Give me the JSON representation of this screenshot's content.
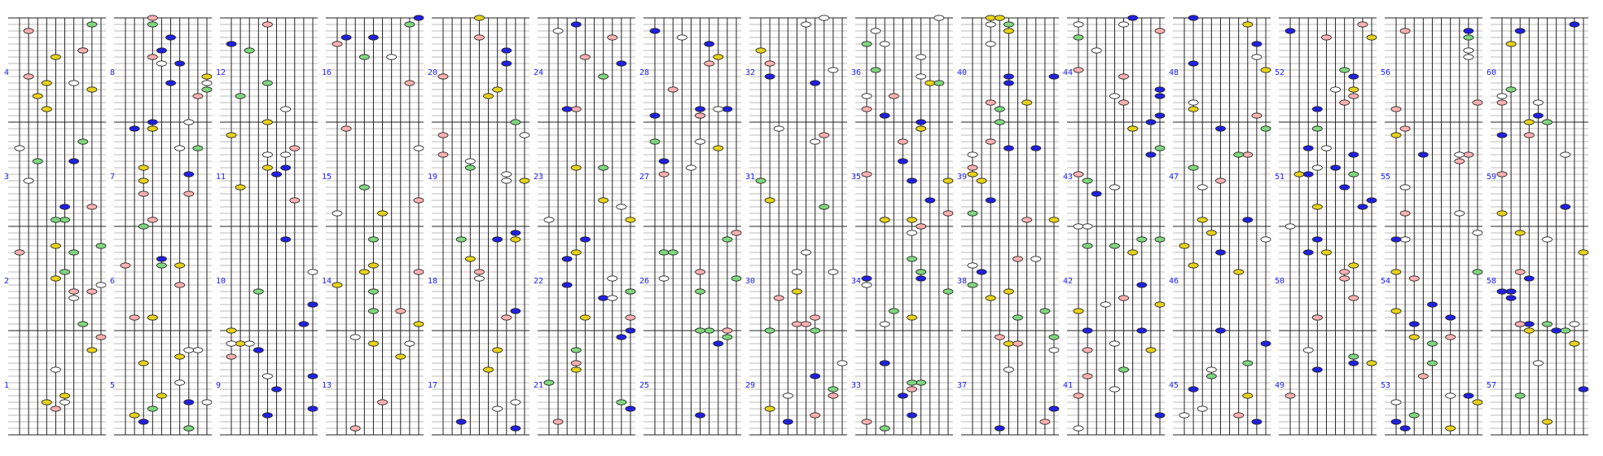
{
  "diagram": {
    "kind": "note-grid",
    "columns": 15,
    "bands_per_column": 4,
    "strings_per_column": 10,
    "band_numbers": [
      [
        4,
        3,
        2,
        1
      ],
      [
        8,
        7,
        6,
        5
      ],
      [
        12,
        11,
        10,
        9
      ],
      [
        16,
        15,
        14,
        13
      ],
      [
        20,
        19,
        18,
        17
      ],
      [
        24,
        23,
        22,
        21
      ],
      [
        28,
        27,
        26,
        25
      ],
      [
        32,
        31,
        30,
        29
      ],
      [
        36,
        35,
        34,
        33
      ],
      [
        40,
        39,
        38,
        37
      ],
      [
        44,
        43,
        42,
        41
      ],
      [
        48,
        47,
        46,
        45
      ],
      [
        52,
        51,
        50,
        49
      ],
      [
        56,
        55,
        54,
        53
      ],
      [
        60,
        59,
        58,
        57
      ]
    ],
    "colors": {
      "line": "#222222",
      "grid_line": "#bbbbbb",
      "label": "#1a1aff",
      "white": "#ffffff",
      "pink": "#ffb0b0",
      "green": "#7fd67f",
      "blue": "#2020e0",
      "yellow": "#e6d21a",
      "outline": "#222222"
    },
    "note_color_order": [
      "white",
      "pink",
      "green",
      "blue",
      "yellow"
    ]
  }
}
